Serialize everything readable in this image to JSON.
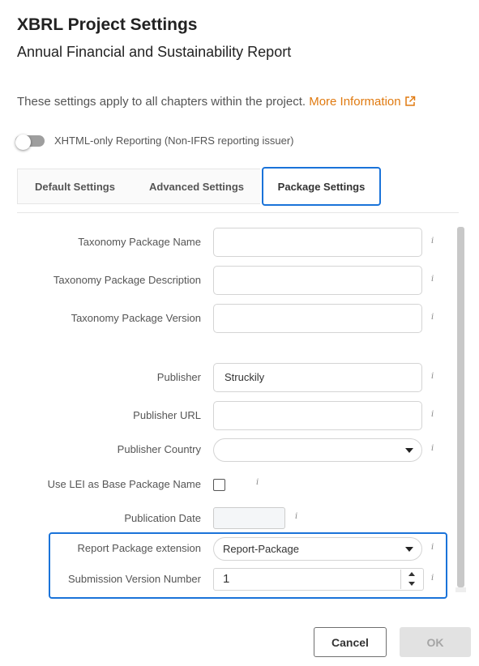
{
  "dialog": {
    "title": "XBRL Project Settings",
    "subtitle": "Annual Financial and Sustainability Report",
    "intro_text": "These settings apply to all chapters within the project.",
    "more_info_link": "More Information",
    "external_link_icon": "external-link-icon"
  },
  "toggle": {
    "label": "XHTML-only Reporting (Non-IFRS reporting issuer)",
    "checked": false
  },
  "tabs": [
    {
      "label": "Default Settings",
      "active": false
    },
    {
      "label": "Advanced Settings",
      "active": false
    },
    {
      "label": "Package Settings",
      "active": true
    }
  ],
  "fields": {
    "taxonomy_package_name": {
      "label": "Taxonomy Package Name",
      "value": ""
    },
    "taxonomy_package_description": {
      "label": "Taxonomy Package Description",
      "value": ""
    },
    "taxonomy_package_version": {
      "label": "Taxonomy Package Version",
      "value": ""
    },
    "publisher": {
      "label": "Publisher",
      "value": "Struckily"
    },
    "publisher_url": {
      "label": "Publisher URL",
      "value": ""
    },
    "publisher_country": {
      "label": "Publisher Country",
      "value": ""
    },
    "use_lei": {
      "label": "Use LEI as Base Package Name",
      "checked": false
    },
    "publication_date": {
      "label": "Publication Date",
      "value": ""
    },
    "report_package_extension": {
      "label": "Report Package extension",
      "value": "Report-Package"
    },
    "submission_version_number": {
      "label": "Submission Version Number",
      "value": "1"
    }
  },
  "info_icon_glyph": "i",
  "buttons": {
    "cancel": "Cancel",
    "ok": "OK"
  },
  "colors": {
    "accent_blue": "#1a73d9",
    "link_orange": "#e07a10",
    "disabled_button": "#e2e2e2"
  }
}
